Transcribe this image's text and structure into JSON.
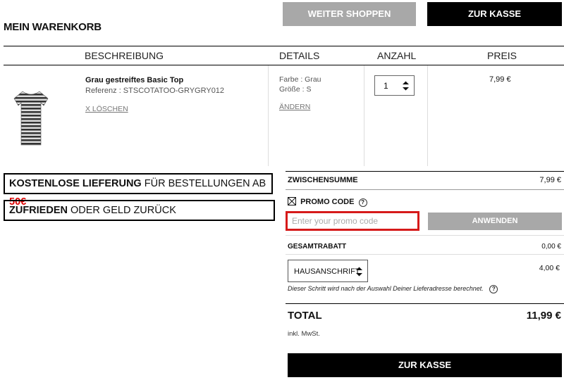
{
  "header": {
    "title": "MEIN WARENKORB",
    "continue_shopping": "WEITER SHOPPEN",
    "checkout_top": "ZUR KASSE"
  },
  "table": {
    "headers": {
      "description": "BESCHREIBUNG",
      "details": "DETAILS",
      "quantity": "ANZAHL",
      "price": "PREIS"
    }
  },
  "item": {
    "name": "Grau gestreiftes Basic Top",
    "reference": "Referenz : STSCOTATOO-GRYGRY012",
    "remove": "X LÖSCHEN",
    "color": "Farbe : Grau",
    "size": "Größe : S",
    "change": "ÄNDERN",
    "quantity": "1",
    "price": "7,99 €"
  },
  "banners": {
    "free_delivery_bold": "KOSTENLOSE LIEFERUNG",
    "free_delivery_text": " FÜR BESTELLUNGEN AB ",
    "free_delivery_amount": "50€",
    "satisfied_bold": "ZUFRIEDEN",
    "satisfied_text": " ODER GELD ZURÜCK"
  },
  "summary": {
    "subtotal_label": "ZWISCHENSUMME",
    "subtotal_value": "7,99 €",
    "promo_label": "PROMO CODE",
    "promo_placeholder": "Enter your promo code",
    "apply": "ANWENDEN",
    "discount_label": "GESAMTRABATT",
    "discount_value": "0,00 €",
    "shipping_option": "HAUSANSCHRIFT",
    "shipping_value": "4,00 €",
    "shipping_note": "Dieser Schritt wird nach der Auswahl Deiner Lieferadresse berechnet.",
    "total_label": "TOTAL",
    "total_value": "11,99 €",
    "vat_note": "inkl. MwSt.",
    "checkout_bottom": "ZUR KASSE"
  }
}
